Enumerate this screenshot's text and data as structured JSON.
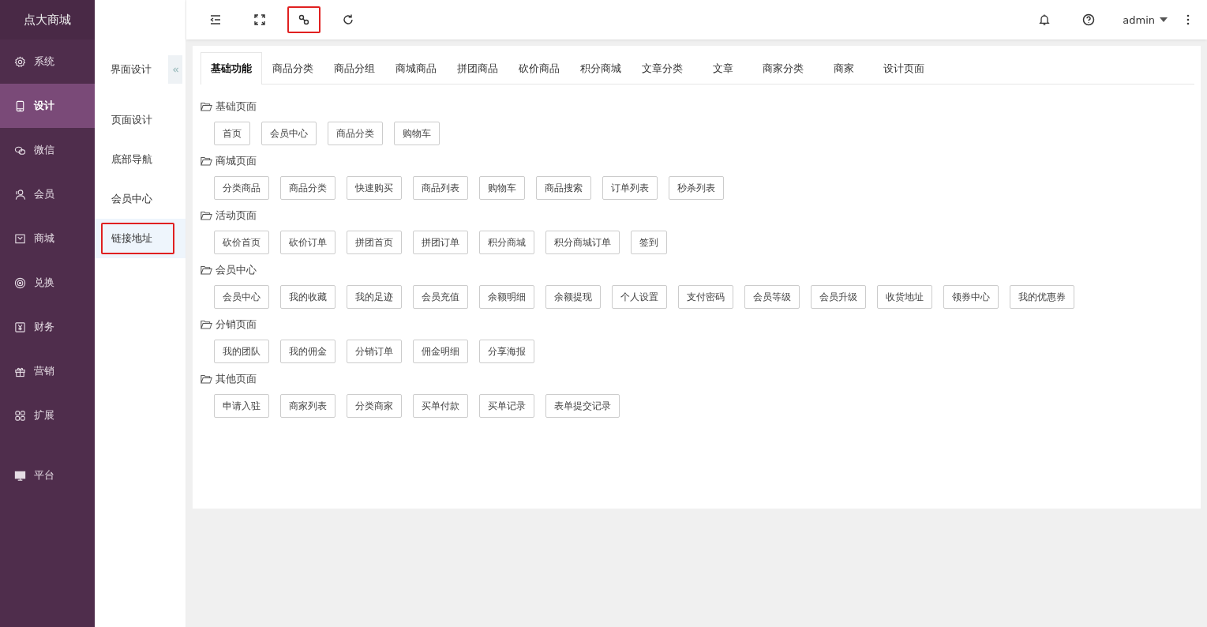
{
  "brand": "点大商城",
  "sidebar": {
    "items": [
      {
        "label": "系统",
        "kind": "gear",
        "selected": false
      },
      {
        "label": "设计",
        "kind": "tablet",
        "selected": true
      },
      {
        "label": "微信",
        "kind": "chat",
        "selected": false
      },
      {
        "label": "会员",
        "kind": "user",
        "selected": false
      },
      {
        "label": "商城",
        "kind": "bag",
        "selected": false
      },
      {
        "label": "兑换",
        "kind": "coin",
        "selected": false
      },
      {
        "label": "财务",
        "kind": "yen",
        "selected": false
      },
      {
        "label": "营销",
        "kind": "gift",
        "selected": false
      },
      {
        "label": "扩展",
        "kind": "grid",
        "selected": false
      }
    ],
    "bottom_items": [
      {
        "label": "平台",
        "kind": "monitor",
        "selected": false
      }
    ]
  },
  "subnav": {
    "title": "界面设计",
    "items": [
      {
        "label": "页面设计",
        "selected": false,
        "highlighted": false
      },
      {
        "label": "底部导航",
        "selected": false,
        "highlighted": false
      },
      {
        "label": "会员中心",
        "selected": false,
        "highlighted": false
      },
      {
        "label": "链接地址",
        "selected": true,
        "highlighted": true
      }
    ]
  },
  "toolbar": {
    "tools": [
      {
        "kind": "indent",
        "highlighted": false
      },
      {
        "kind": "fullscreen",
        "highlighted": false
      },
      {
        "kind": "link",
        "highlighted": true
      },
      {
        "kind": "refresh",
        "highlighted": false
      }
    ],
    "user": "admin"
  },
  "tabs": [
    {
      "label": "基础功能",
      "selected": true
    },
    {
      "label": "商品分类",
      "selected": false
    },
    {
      "label": "商品分组",
      "selected": false
    },
    {
      "label": "商城商品",
      "selected": false
    },
    {
      "label": "拼团商品",
      "selected": false
    },
    {
      "label": "砍价商品",
      "selected": false
    },
    {
      "label": "积分商城",
      "selected": false
    },
    {
      "label": "文章分类",
      "selected": false
    },
    {
      "label": "文章",
      "selected": false
    },
    {
      "label": "商家分类",
      "selected": false
    },
    {
      "label": "商家",
      "selected": false
    },
    {
      "label": "设计页面",
      "selected": false
    }
  ],
  "sections": [
    {
      "title": "基础页面",
      "links": [
        "首页",
        "会员中心",
        "商品分类",
        "购物车"
      ]
    },
    {
      "title": "商城页面",
      "links": [
        "分类商品",
        "商品分类",
        "快速购买",
        "商品列表",
        "购物车",
        "商品搜索",
        "订单列表",
        "秒杀列表"
      ]
    },
    {
      "title": "活动页面",
      "links": [
        "砍价首页",
        "砍价订单",
        "拼团首页",
        "拼团订单",
        "积分商城",
        "积分商城订单",
        "签到"
      ]
    },
    {
      "title": "会员中心",
      "links": [
        "会员中心",
        "我的收藏",
        "我的足迹",
        "会员充值",
        "余额明细",
        "余额提现",
        "个人设置",
        "支付密码",
        "会员等级",
        "会员升级",
        "收货地址",
        "领券中心",
        "我的优惠券"
      ]
    },
    {
      "title": "分销页面",
      "links": [
        "我的团队",
        "我的佣金",
        "分销订单",
        "佣金明细",
        "分享海报"
      ]
    },
    {
      "title": "其他页面",
      "links": [
        "申请入驻",
        "商家列表",
        "分类商家",
        "买单付款",
        "买单记录",
        "表单提交记录"
      ]
    }
  ]
}
